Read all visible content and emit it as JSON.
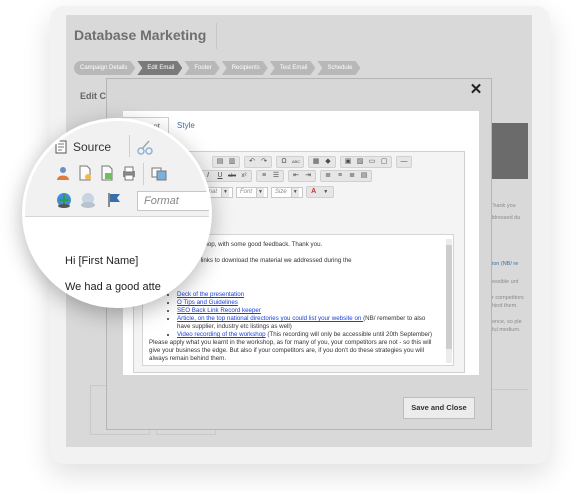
{
  "app": {
    "title": "Database Marketing"
  },
  "steps": [
    {
      "label": "Campaign Details",
      "active": false
    },
    {
      "label": "Edit Email",
      "active": true
    },
    {
      "label": "Footer",
      "active": false
    },
    {
      "label": "Recipients",
      "active": false
    },
    {
      "label": "Test Email",
      "active": false
    },
    {
      "label": "Schedule",
      "active": false
    }
  ],
  "page": {
    "edit_heading": "Edit C"
  },
  "background_snippets": {
    "thank": "Thank you",
    "addressed": "ddressed du",
    "ion": "ion (NB/ re",
    "essible": "essible unt",
    "competitors": "r competitors",
    "hind": "hind them.",
    "ence": "ence, so ple",
    "ful": "ful medium."
  },
  "modal": {
    "tabs": [
      {
        "label": "Content",
        "active": true
      },
      {
        "label": "Style",
        "active": false
      }
    ],
    "close_symbol": "✕",
    "save_label": "Save and Close"
  },
  "toolbar": {
    "format_placeholder": "Format",
    "font_placeholder": "Font",
    "size_placeholder": "Size",
    "bold": "B",
    "italic": "I",
    "underline": "U",
    "strike": "abc",
    "superscript": "x²",
    "omega": "Ω",
    "spell": "ABC"
  },
  "editor_content": {
    "p1": "ndance at the workshop, with some good feedback.  Thank you.",
    "p2": "ase find below the links to download the material we addressed during the",
    "links": [
      {
        "text": "Deck of the presentation",
        "suffix": ""
      },
      {
        "text": "O Tips and Guidelines",
        "suffix": ""
      },
      {
        "text": "SEO Back Link Record keeper",
        "suffix": ""
      },
      {
        "text": "Article, on the top national directories you could list your website on ",
        "suffix": "(NB/ remember to also have supplier, industry etc listings as well)"
      },
      {
        "text": "Video recording of the workshop",
        "suffix": " (This recording will only be accessible until 20th September)"
      }
    ],
    "p3": "Please apply what you learnt in the workshop, as for many of you, your competitors are not - so this will give your business the edge.  But also if your competitors are, if you don't do these strategies you will always remain behind them."
  },
  "magnifier": {
    "source_label": "Source",
    "format_placeholder": "Format",
    "greeting": "Hi [First Name]",
    "line2": "We had a good atte"
  }
}
